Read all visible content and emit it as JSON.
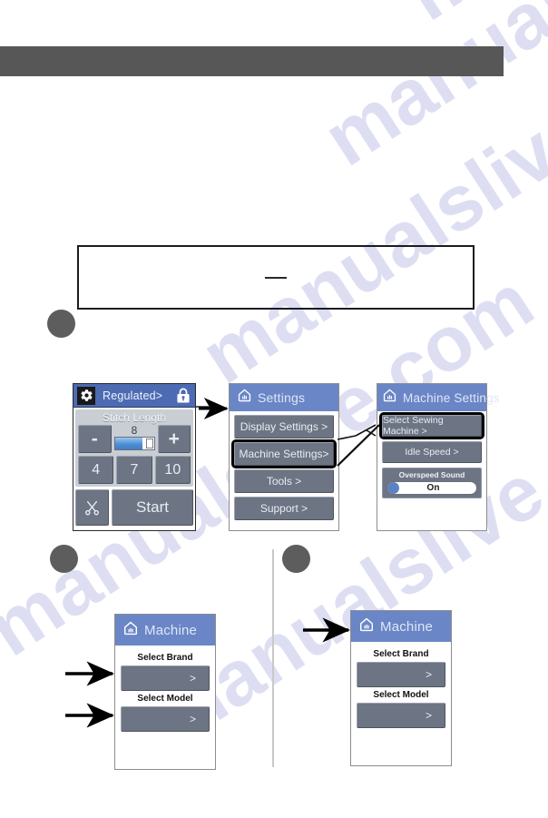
{
  "page": {
    "watermark_text": "manualslive.com",
    "topbar_color": "#575757",
    "accent_header_color": "#6a86c6",
    "button_color": "#6d7584",
    "selection_outline_color": "#000000"
  },
  "note_box": {
    "content": "",
    "dash": ""
  },
  "steps": [
    {
      "label": ""
    },
    {
      "label": ""
    },
    {
      "label": ""
    }
  ],
  "screens": {
    "regulated": {
      "header": {
        "gear_icon": "gear-icon",
        "title": "Regulated>",
        "lock_icon": "lock-icon"
      },
      "stitch_length": {
        "label": "Stitch Length",
        "value": "8",
        "minus_label": "-",
        "plus_label": "+",
        "slider_percent": 72
      },
      "presets": [
        "4",
        "7",
        "10"
      ],
      "cut_icon": "scissors-icon",
      "start_label": "Start"
    },
    "settings": {
      "header": {
        "home_icon": "home-icon",
        "title": "Settings"
      },
      "items": [
        {
          "label": "Display Settings >",
          "selected": false
        },
        {
          "label": "Machine Settings>",
          "selected": true
        },
        {
          "label": "Tools >",
          "selected": false
        },
        {
          "label": "Support >",
          "selected": false
        }
      ]
    },
    "machine_settings": {
      "header": {
        "home_icon": "home-icon",
        "title": "Machine Settings"
      },
      "items": [
        {
          "label": "Select Sewing Machine >",
          "selected": true
        },
        {
          "label": "Idle Speed >",
          "selected": false
        }
      ],
      "overspeed_sound": {
        "label": "Overspeed Sound",
        "state": "On"
      }
    },
    "machine_left": {
      "header": {
        "home_icon": "home-icon",
        "title": "Machine"
      },
      "fields": [
        {
          "label": "Select Brand",
          "value": ">"
        },
        {
          "label": "Select Model",
          "value": ">"
        }
      ]
    },
    "machine_right": {
      "header": {
        "home_icon": "home-icon",
        "title": "Machine"
      },
      "fields": [
        {
          "label": "Select Brand",
          "value": ">"
        },
        {
          "label": "Select Model",
          "value": ">"
        }
      ]
    }
  }
}
